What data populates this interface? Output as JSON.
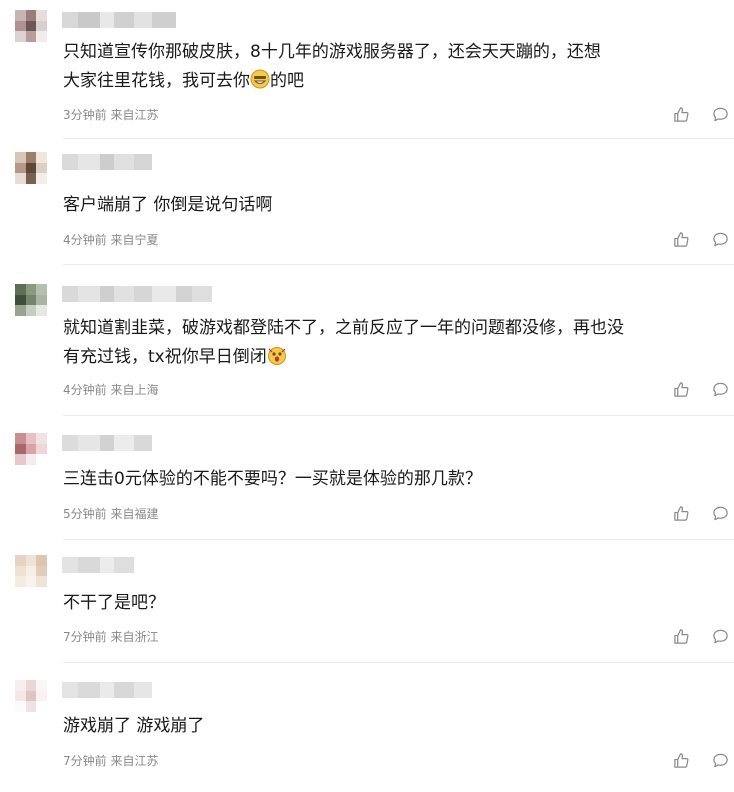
{
  "comments": [
    {
      "text_lines": [
        "只知道宣传你那破皮肤，8十几年的游戏服务器了，还会天天蹦的，还想",
        "大家往里花钱，我可去你",
        "的吧"
      ],
      "meta": "3分钟前 来自江苏",
      "avatar_colors": [
        "#c9b4b4",
        "#9a7e7e",
        "#e6dddd",
        "#b09090",
        "#6b5757",
        "#d8cfd0",
        "#dcd2d2",
        "#b99d9d",
        "#f2eded"
      ],
      "name_colors": [
        "#d8d8d8",
        "#c9c9c9",
        "#e8e8e8",
        "#d0d0d0",
        "#e2e2e2",
        "#cfcfcf"
      ]
    },
    {
      "text_lines": [
        "客户端崩了 你倒是说句话啊"
      ],
      "meta": "4分钟前 来自宁夏",
      "avatar_colors": [
        "#d8c7b8",
        "#9c7f6b",
        "#efe6dc",
        "#b49a86",
        "#5f4838",
        "#dcd0c4",
        "#e6dcd2",
        "#7a604e",
        "#f3eee8"
      ],
      "name_colors": [
        "#dadada",
        "#e6e6e6",
        "#cdcdcd",
        "#e0e0e0",
        "#d5d5d5"
      ]
    },
    {
      "text_lines": [
        "就知道割韭菜，破游戏都登陆不了，之前反应了一年的问题都没修，再也没",
        "有充过钱，tx祝你早日倒闭"
      ],
      "meta": "4分钟前 来自上海",
      "avatar_colors": [
        "#5f6f57",
        "#8a9a80",
        "#b4bfae",
        "#404d3a",
        "#76856d",
        "#a9b5a2",
        "#9aa392",
        "#c6cdc0",
        "#e4e8e0"
      ],
      "name_colors": [
        "#d9d9d9",
        "#e4e4e4",
        "#cfcfcf",
        "#e1e1e1",
        "#d6d6d6",
        "#e9e9e9",
        "#d3d3d3",
        "#dedede"
      ]
    },
    {
      "text_lines": [
        "三连击0元体验的不能不要吗？一买就是体验的那几款？"
      ],
      "meta": "5分钟前 来自福建",
      "avatar_colors": [
        "#c98e92",
        "#e6c0c3",
        "#f3e2e3",
        "#a8686d",
        "#d9a4a8",
        "#efd6d8",
        "#e7c9cb",
        "#f6eced",
        "#ffffff"
      ],
      "name_colors": [
        "#dcdcdc",
        "#e6e6e6",
        "#d2d2d2",
        "#ececec",
        "#d9d9d9"
      ]
    },
    {
      "text_lines": [
        "不干了是吧？"
      ],
      "meta": "7分钟前 来自浙江",
      "avatar_colors": [
        "#e7d3c3",
        "#f0e3d6",
        "#dcc5b1",
        "#efe2d4",
        "#f6efe7",
        "#e2cdbb",
        "#f4ebe1",
        "#f9f3ec",
        "#eee3d7"
      ],
      "name_colors": [
        "#e3e3e3",
        "#d9d9d9",
        "#ececec",
        "#dedede"
      ]
    },
    {
      "text_lines": [
        "游戏崩了 游戏崩了"
      ],
      "meta": "7分钟前 来自江苏",
      "avatar_colors": [
        "#f7efef",
        "#e9d6d6",
        "#fbf6f6",
        "#f3e8e8",
        "#dfc4c4",
        "#f8f2f2",
        "#fdfafa",
        "#efe2e2",
        "#ffffff"
      ],
      "name_colors": [
        "#e4e4e4",
        "#dadada",
        "#eaeaea",
        "#d8d8d8",
        "#e6e6e6"
      ]
    }
  ]
}
